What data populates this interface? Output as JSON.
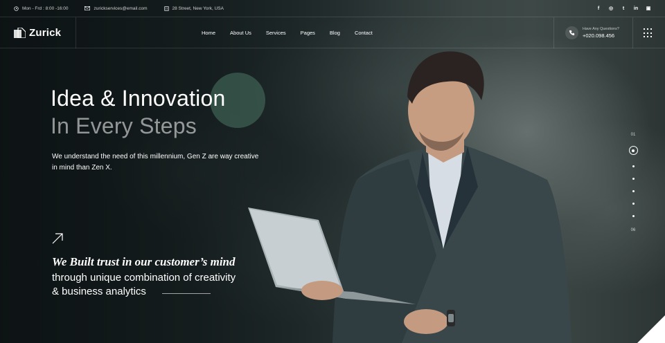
{
  "topbar": {
    "hours": "Mon - Frd : 8:00 -16:00",
    "email": "zurickservices@email.com",
    "address": "28 Street, New York, USA",
    "socials": [
      "f",
      "◎",
      "t",
      "in",
      "▣"
    ]
  },
  "brand": {
    "name": "Zurick"
  },
  "nav": {
    "items": [
      "Home",
      "About Us",
      "Services",
      "Pages",
      "Blog",
      "Contact"
    ]
  },
  "contact": {
    "question": "Have Any Questions?",
    "phone": "+020.098.456"
  },
  "hero": {
    "title_line1": "Idea & Innovation",
    "title_line2": "In Every Steps",
    "description": "We understand the need of this millennium, Gen Z are way creative in mind than Zen X.",
    "tagline_italic": "We Built trust in our customer’s mind",
    "tagline_line1": "through unique combination of creativity",
    "tagline_line2": "& business analytics"
  },
  "pager": {
    "first": "01",
    "last": "06",
    "active_index": 1,
    "total": 6
  },
  "colors": {
    "accent_circle": "#4a7664",
    "bg_dark": "#1a2223"
  },
  "icons": [
    "clock-icon",
    "mail-icon",
    "building-icon",
    "phone-icon",
    "grid-menu-icon",
    "arrow-up-right-icon"
  ]
}
